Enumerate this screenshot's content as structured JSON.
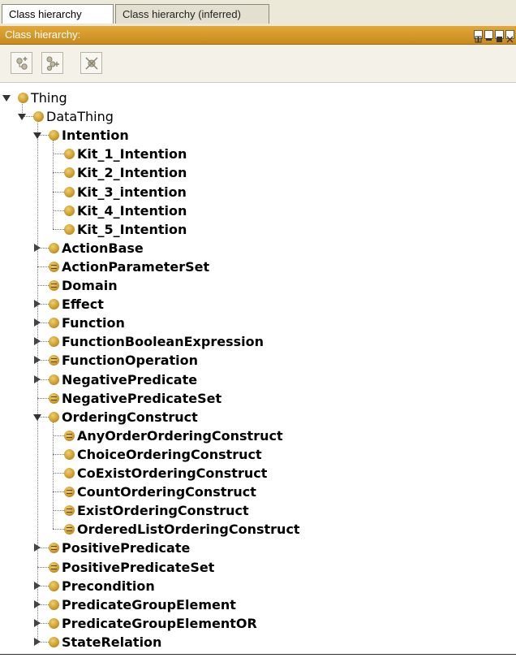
{
  "tabs": [
    {
      "label": "Class hierarchy",
      "active": true
    },
    {
      "label": "Class hierarchy (inferred)",
      "active": false
    }
  ],
  "panel": {
    "title": "Class hierarchy:",
    "accent_color": "#d9982a"
  },
  "toolbar": {
    "buttons": [
      {
        "icon": "add-subclass-icon"
      },
      {
        "icon": "add-sibling-class-icon"
      },
      {
        "icon": "delete-class-icon"
      }
    ]
  },
  "window_buttons": [
    "restore-icon",
    "minimize-icon",
    "maximize-icon",
    "close-icon"
  ],
  "tree": {
    "nodes": [
      {
        "label": "Thing",
        "depth": 0,
        "expander": "open",
        "icon": "class-icon"
      },
      {
        "label": "DataThing",
        "depth": 1,
        "expander": "open",
        "icon": "class-icon"
      },
      {
        "label": "Intention",
        "depth": 2,
        "expander": "open",
        "icon": "class-icon"
      },
      {
        "label": "Kit_1_Intention",
        "depth": 3,
        "expander": "none",
        "icon": "class-icon"
      },
      {
        "label": "Kit_2_Intention",
        "depth": 3,
        "expander": "none",
        "icon": "class-icon"
      },
      {
        "label": "Kit_3_intention",
        "depth": 3,
        "expander": "none",
        "icon": "class-icon"
      },
      {
        "label": "Kit_4_Intention",
        "depth": 3,
        "expander": "none",
        "icon": "class-icon"
      },
      {
        "label": "Kit_5_Intention",
        "depth": 3,
        "expander": "none",
        "icon": "class-icon"
      },
      {
        "label": "ActionBase",
        "depth": 2,
        "expander": "closed",
        "icon": "class-icon"
      },
      {
        "label": "ActionParameterSet",
        "depth": 2,
        "expander": "none",
        "icon": "defined-class-icon"
      },
      {
        "label": "Domain",
        "depth": 2,
        "expander": "none",
        "icon": "defined-class-icon"
      },
      {
        "label": "Effect",
        "depth": 2,
        "expander": "closed",
        "icon": "class-icon"
      },
      {
        "label": "Function",
        "depth": 2,
        "expander": "closed",
        "icon": "class-icon"
      },
      {
        "label": "FunctionBooleanExpression",
        "depth": 2,
        "expander": "closed",
        "icon": "class-icon"
      },
      {
        "label": "FunctionOperation",
        "depth": 2,
        "expander": "closed",
        "icon": "defined-class-icon"
      },
      {
        "label": "NegativePredicate",
        "depth": 2,
        "expander": "closed",
        "icon": "class-icon"
      },
      {
        "label": "NegativePredicateSet",
        "depth": 2,
        "expander": "none",
        "icon": "defined-class-icon"
      },
      {
        "label": "OrderingConstruct",
        "depth": 2,
        "expander": "open",
        "icon": "class-icon"
      },
      {
        "label": "AnyOrderOrderingConstruct",
        "depth": 3,
        "expander": "none",
        "icon": "defined-class-icon"
      },
      {
        "label": "ChoiceOrderingConstruct",
        "depth": 3,
        "expander": "none",
        "icon": "class-icon"
      },
      {
        "label": "CoExistOrderingConstruct",
        "depth": 3,
        "expander": "none",
        "icon": "class-icon"
      },
      {
        "label": "CountOrderingConstruct",
        "depth": 3,
        "expander": "none",
        "icon": "defined-class-icon"
      },
      {
        "label": "ExistOrderingConstruct",
        "depth": 3,
        "expander": "none",
        "icon": "defined-class-icon"
      },
      {
        "label": "OrderedListOrderingConstruct",
        "depth": 3,
        "expander": "none",
        "icon": "defined-class-icon"
      },
      {
        "label": "PositivePredicate",
        "depth": 2,
        "expander": "closed",
        "icon": "defined-class-icon"
      },
      {
        "label": "PositivePredicateSet",
        "depth": 2,
        "expander": "none",
        "icon": "defined-class-icon"
      },
      {
        "label": "Precondition",
        "depth": 2,
        "expander": "closed",
        "icon": "class-icon"
      },
      {
        "label": "PredicateGroupElement",
        "depth": 2,
        "expander": "closed",
        "icon": "class-icon"
      },
      {
        "label": "PredicateGroupElementOR",
        "depth": 2,
        "expander": "closed",
        "icon": "class-icon"
      },
      {
        "label": "StateRelation",
        "depth": 2,
        "expander": "closed",
        "icon": "class-icon"
      }
    ]
  }
}
